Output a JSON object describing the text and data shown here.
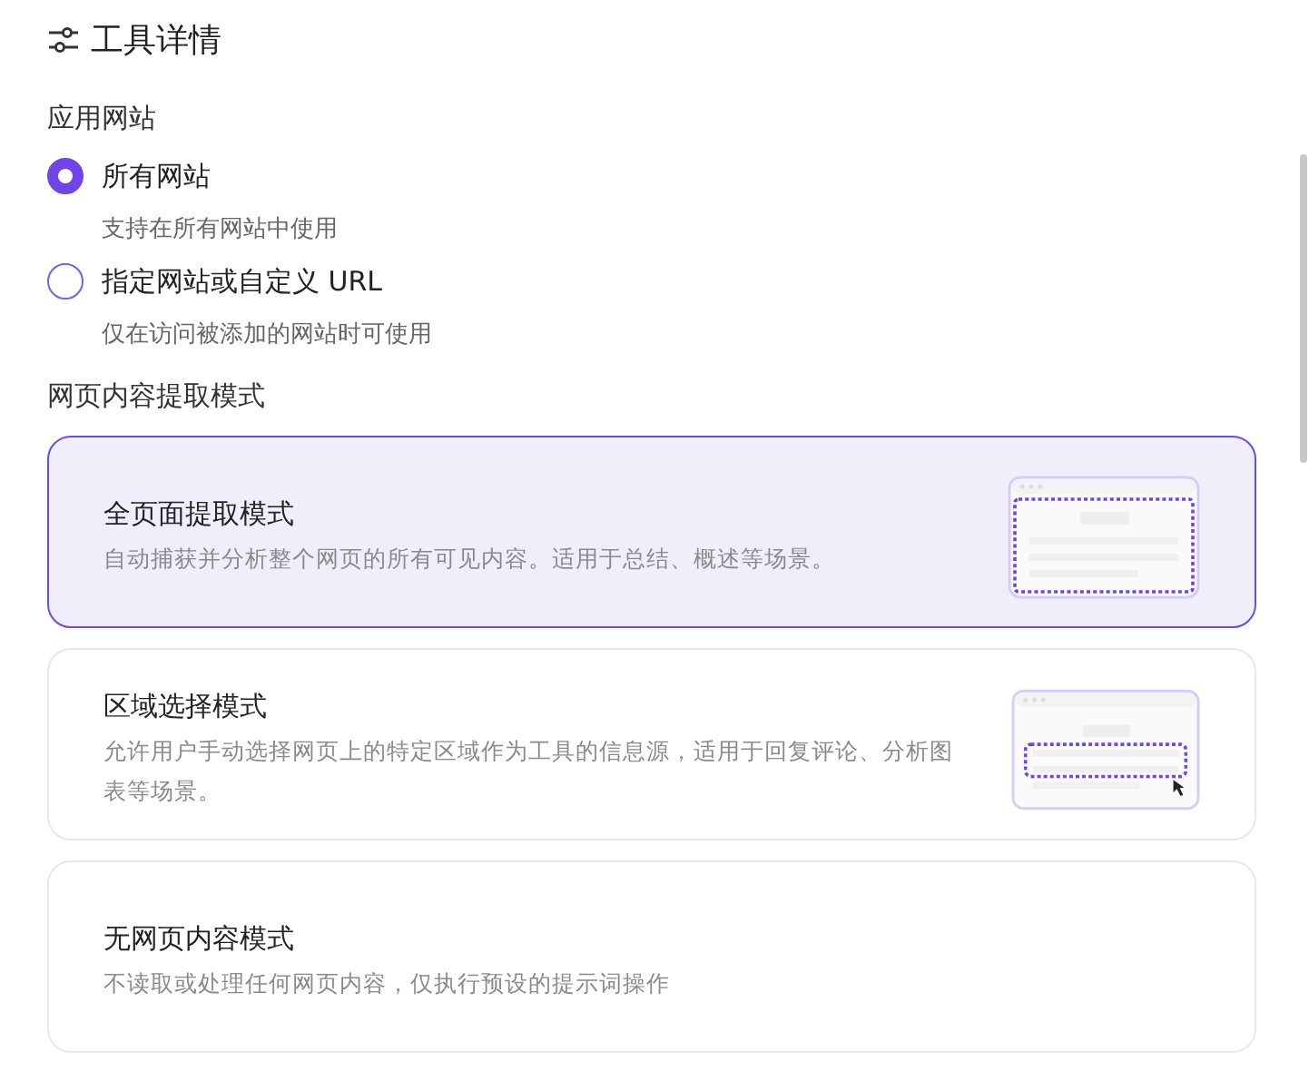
{
  "header": {
    "title": "工具详情"
  },
  "site_section": {
    "label": "应用网站",
    "options": [
      {
        "label": "所有网站",
        "hint": "支持在所有网站中使用",
        "selected": true
      },
      {
        "label": "指定网站或自定义 URL",
        "hint": "仅在访问被添加的网站时可使用",
        "selected": false
      }
    ]
  },
  "mode_section": {
    "label": "网页内容提取模式",
    "modes": [
      {
        "kind": "full",
        "title": "全页面提取模式",
        "description": "自动捕获并分析整个网页的所有可见内容。适用于总结、概述等场景。",
        "selected": true
      },
      {
        "kind": "region",
        "title": "区域选择模式",
        "description": "允许用户手动选择网页上的特定区域作为工具的信息源，适用于回复评论、分析图表等场景。",
        "selected": false
      },
      {
        "kind": "none",
        "title": "无网页内容模式",
        "description": "不读取或处理任何网页内容，仅执行预设的提示词操作",
        "selected": false
      }
    ]
  }
}
